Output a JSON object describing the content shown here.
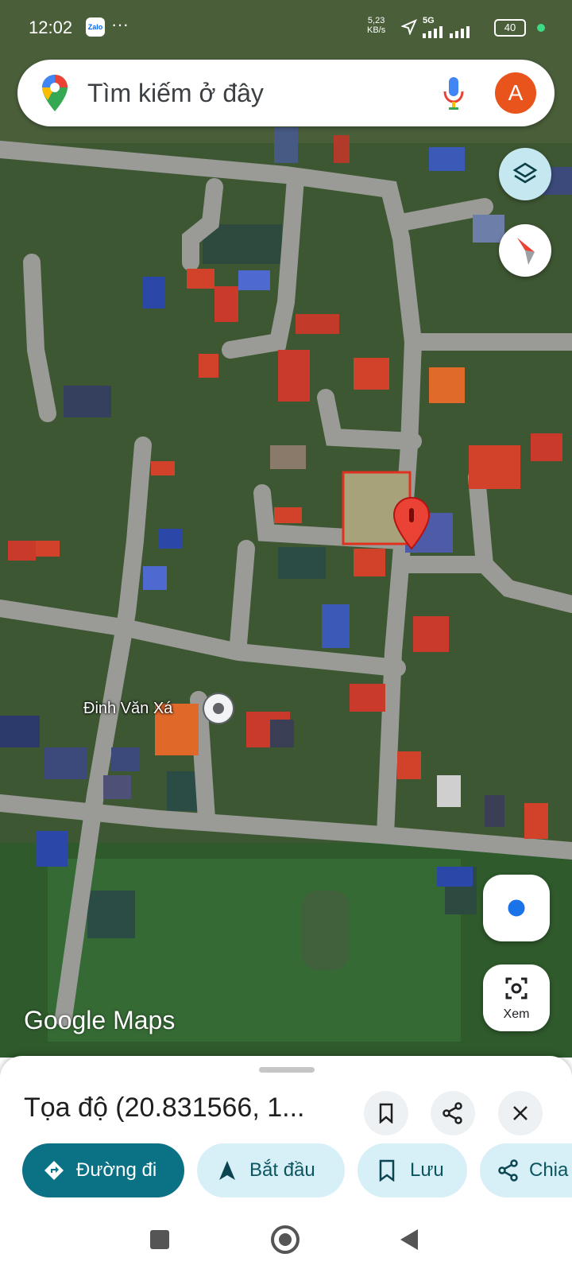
{
  "status_bar": {
    "time": "12:02",
    "app_icon": "Zalo",
    "more": "···",
    "speed_value": "5,23",
    "speed_unit": "KB/s",
    "network": "5G",
    "battery": "40"
  },
  "search": {
    "placeholder": "Tìm kiếm ở đây",
    "avatar_letter": "A"
  },
  "map": {
    "poi_name": "Đinh Văn Xá",
    "brand_google": "Google",
    "brand_maps": "Maps"
  },
  "lens": {
    "label": "Xem"
  },
  "sheet": {
    "title": "Tọa độ (20.831566, 1...",
    "actions": {
      "directions": "Đường đi",
      "start": "Bắt đầu",
      "save": "Lưu",
      "share": "Chia"
    }
  },
  "colors": {
    "accent": "#0b7286",
    "chip": "#d7eff6",
    "pin": "#ea4335",
    "highlight_box": "#e0301e"
  }
}
